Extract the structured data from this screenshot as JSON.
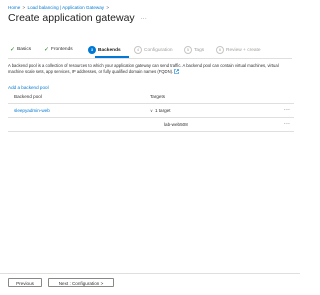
{
  "breadcrumb": {
    "items": [
      "Home",
      "Load balancing | Application Gateway"
    ],
    "separator": ">"
  },
  "header": {
    "title": "Create application gateway",
    "more_label": "..."
  },
  "tabs": [
    {
      "label": "Basics",
      "state": "done",
      "marker": "✓"
    },
    {
      "label": "Frontends",
      "state": "done",
      "marker": "✓"
    },
    {
      "label": "Backends",
      "state": "active",
      "marker": "3"
    },
    {
      "label": "Configuration",
      "state": "disabled",
      "marker": "4"
    },
    {
      "label": "Tags",
      "state": "disabled",
      "marker": "5"
    },
    {
      "label": "Review + create",
      "state": "disabled",
      "marker": "6"
    }
  ],
  "main": {
    "description": "A backend pool is a collection of resources to which your application gateway can send traffic. A backend pool can contain virtual machines, virtual machine scale sets, app services, IP addresses, or fully qualified domain names (FQDN).",
    "add_link": "Add a backend pool",
    "columns": [
      "Backend pool",
      "Targets"
    ],
    "rows": [
      {
        "pool": "sleepyadmin-web",
        "targets": "1 target",
        "target_items": [
          "lab-web508"
        ]
      }
    ]
  },
  "footer": {
    "previous_label": "Previous",
    "next_label": "Next : Configuration >"
  },
  "colors": {
    "accent": "#0078d4",
    "success": "#107c10",
    "border": "#e1dfdd"
  }
}
